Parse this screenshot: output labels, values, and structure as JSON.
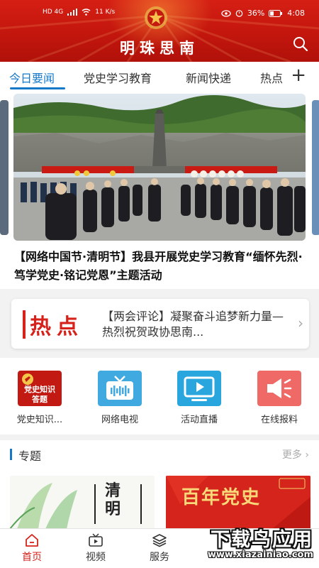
{
  "status_bar": {
    "network": "HD 4G",
    "speed": "11 K/s",
    "battery": "36%",
    "time": "4:08"
  },
  "app": {
    "title": "明珠思南"
  },
  "tabs": [
    {
      "label": "今日要闻",
      "active": true
    },
    {
      "label": "党史学习教育",
      "active": false
    },
    {
      "label": "新闻快递",
      "active": false
    },
    {
      "label": "热点",
      "active": false
    }
  ],
  "carousel": {
    "caption": "【网络中国节·清明节】我县开展党史学习教育“缅怀先烈·笃学党史·铭记党恩”主题活动"
  },
  "hot": {
    "label": "热点",
    "text": "【两会评论】凝聚奋斗追梦新力量—热烈祝贺政协思南..."
  },
  "grid": [
    {
      "label": "党史知识...",
      "icon": "party-history-quiz-icon"
    },
    {
      "label": "网络电视",
      "icon": "tv-icon"
    },
    {
      "label": "活动直播",
      "icon": "live-play-icon"
    },
    {
      "label": "在线报料",
      "icon": "megaphone-icon"
    }
  ],
  "topics": {
    "title": "专题",
    "more": "更多",
    "card1_text": "清明",
    "card2_text": "百年党史"
  },
  "bottom_nav": [
    {
      "label": "首页",
      "active": true
    },
    {
      "label": "视频",
      "active": false
    },
    {
      "label": "服务",
      "active": false
    }
  ],
  "watermark": {
    "main": "下载鸟应用",
    "sub": "www.xiazainiao.com"
  },
  "colors": {
    "brand_red": "#d6221b",
    "accent_blue": "#1578c9"
  }
}
